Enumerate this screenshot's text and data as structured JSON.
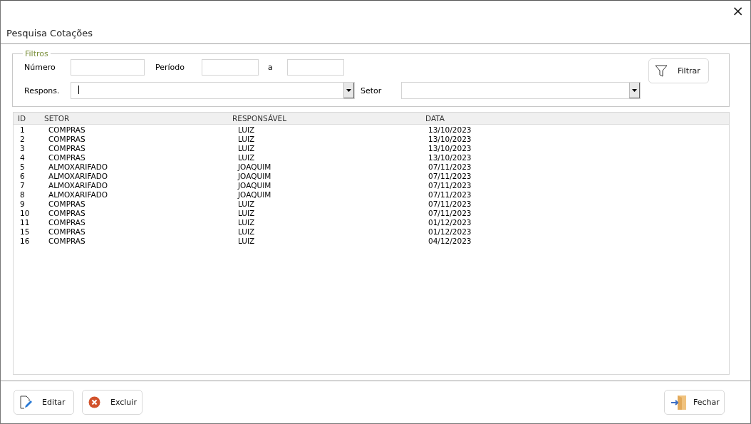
{
  "window": {
    "title": "Pesquisa Cotações",
    "close": "×"
  },
  "filters": {
    "legend": "Filtros",
    "numero_label": "Número",
    "periodo_label": "Período",
    "a_label": "a",
    "respons_label": "Respons.",
    "setor_label": "Setor",
    "filter_button": "Filtrar"
  },
  "table": {
    "columns": [
      "ID",
      "SETOR",
      "RESPONSÁVEL",
      "DATA"
    ],
    "rows": [
      [
        "1",
        "COMPRAS",
        "LUIZ",
        "13/10/2023"
      ],
      [
        "2",
        "COMPRAS",
        "LUIZ",
        "13/10/2023"
      ],
      [
        "3",
        "COMPRAS",
        "LUIZ",
        "13/10/2023"
      ],
      [
        "4",
        "COMPRAS",
        "LUIZ",
        "13/10/2023"
      ],
      [
        "5",
        "ALMOXARIFADO",
        "JOAQUIM",
        "07/11/2023"
      ],
      [
        "6",
        "ALMOXARIFADO",
        "JOAQUIM",
        "07/11/2023"
      ],
      [
        "7",
        "ALMOXARIFADO",
        "JOAQUIM",
        "07/11/2023"
      ],
      [
        "8",
        "ALMOXARIFADO",
        "JOAQUIM",
        "07/11/2023"
      ],
      [
        "9",
        "COMPRAS",
        "LUIZ",
        "07/11/2023"
      ],
      [
        "10",
        "COMPRAS",
        "LUIZ",
        "07/11/2023"
      ],
      [
        "11",
        "COMPRAS",
        "LUIZ",
        "01/12/2023"
      ],
      [
        "15",
        "COMPRAS",
        "LUIZ",
        "01/12/2023"
      ],
      [
        "16",
        "COMPRAS",
        "LUIZ",
        "04/12/2023"
      ]
    ]
  },
  "buttons": [
    {
      "label": "Editar",
      "kind": "edit"
    },
    {
      "label": "Excluir",
      "kind": "delete"
    },
    {
      "label": "Fechar",
      "kind": "close"
    }
  ]
}
